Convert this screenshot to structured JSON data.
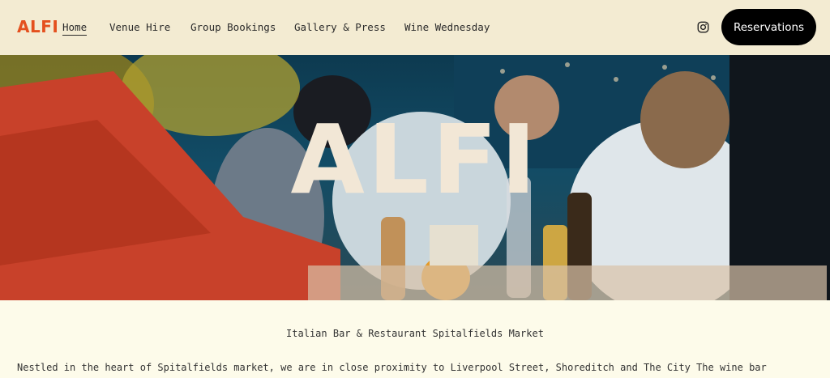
{
  "header": {
    "logo": "ALFI",
    "nav": [
      {
        "label": "Home"
      },
      {
        "label": "Venue Hire"
      },
      {
        "label": "Group Bookings"
      },
      {
        "label": "Gallery & Press"
      },
      {
        "label": "Wine Wednesday"
      }
    ],
    "instagram_icon": "instagram-icon",
    "reservations_label": "Reservations"
  },
  "hero": {
    "title": "ALFI"
  },
  "content": {
    "subtitle": "Italian Bar & Restaurant Spitalfields Market",
    "paragraph": "Nestled in the heart of Spitalfields market, we are in close proximity to Liverpool Street, Shoreditch and The City  The wine bar"
  },
  "colors": {
    "brand": "#E4501E",
    "header_bg": "#F3EBD2",
    "page_bg": "#FDFBEA",
    "button_bg": "#000000",
    "hero_text": "#F2E7D6"
  }
}
